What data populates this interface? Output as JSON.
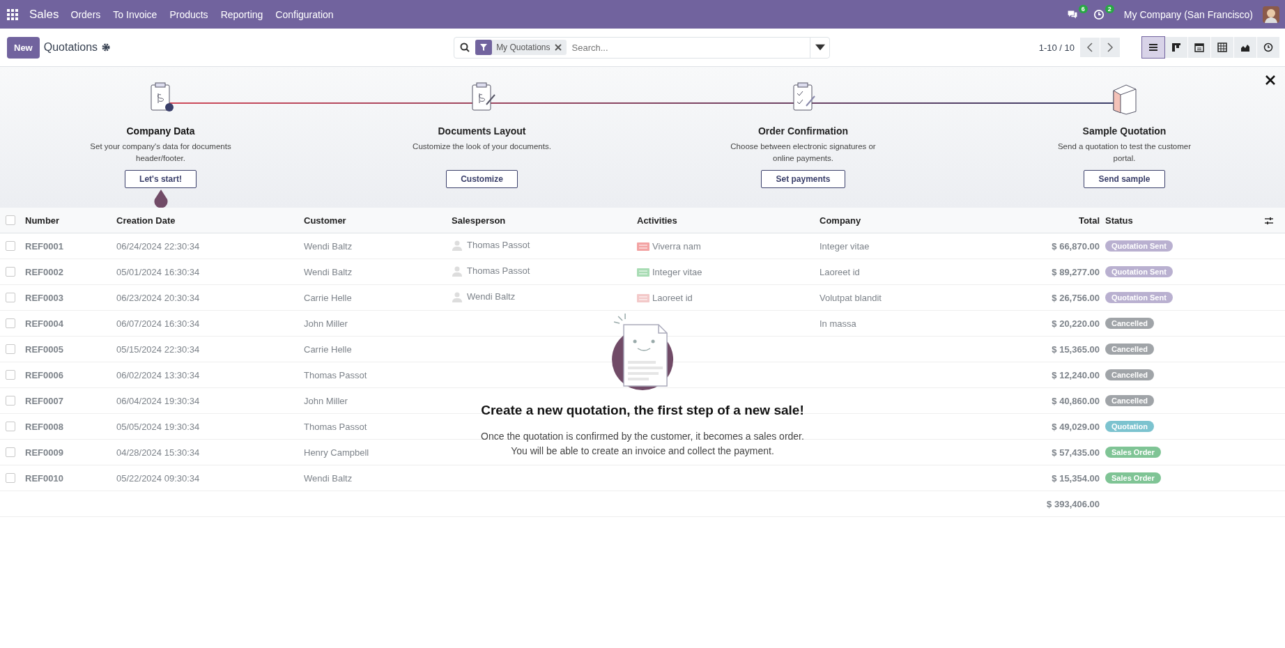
{
  "navbar": {
    "menu": [
      {
        "label": "Sales",
        "kind": "app"
      },
      {
        "label": "Orders",
        "kind": "menu"
      },
      {
        "label": "To Invoice",
        "kind": "menu"
      },
      {
        "label": "Products",
        "kind": "menu"
      },
      {
        "label": "Reporting",
        "kind": "menu"
      },
      {
        "label": "Configuration",
        "kind": "menu"
      }
    ],
    "messages_count": "6",
    "activities_count": "2",
    "company": "My Company (San Francisco)"
  },
  "control_panel": {
    "new_button": "New",
    "breadcrumb": "Quotations",
    "search": {
      "facet": "My Quotations",
      "placeholder": "Search..."
    },
    "pager": "1-10 / 10",
    "views": [
      {
        "kind": "list",
        "selected": true
      },
      {
        "kind": "kanban",
        "selected": false
      },
      {
        "kind": "calendar",
        "selected": false
      },
      {
        "kind": "pivot",
        "selected": false
      },
      {
        "kind": "graph",
        "selected": false
      },
      {
        "kind": "activity",
        "selected": false
      }
    ]
  },
  "onboarding": {
    "steps": [
      {
        "title": "Company Data",
        "description": "Set your company's data for documents header/footer.",
        "button": "Let's start!",
        "current": true
      },
      {
        "title": "Documents Layout",
        "description": "Customize the look of your documents.",
        "button": "Customize",
        "current": false
      },
      {
        "title": "Order Confirmation",
        "description": "Choose between electronic signatures or online payments.",
        "button": "Set payments",
        "current": false
      },
      {
        "title": "Sample Quotation",
        "description": "Send a quotation to test the customer portal.",
        "button": "Send sample",
        "current": false
      }
    ]
  },
  "table": {
    "columns": [
      "Number",
      "Creation Date",
      "Customer",
      "Salesperson",
      "Activities",
      "Company",
      "Total",
      "Status"
    ],
    "all_checked": false,
    "rows": [
      {
        "checked": false,
        "number": "REF0001",
        "date": "06/24/2024 22:30:34",
        "customer": "Wendi Baltz",
        "salesperson": "Thomas Passot",
        "activity": {
          "label": "Viverra nam",
          "color": "#f3a3a3"
        },
        "company": "Integer vitae",
        "total": "$ 66,870.00",
        "status": {
          "label": "Quotation Sent",
          "color": "#b9b0d0"
        }
      },
      {
        "checked": false,
        "number": "REF0002",
        "date": "05/01/2024 16:30:34",
        "customer": "Wendi Baltz",
        "salesperson": "Thomas Passot",
        "activity": {
          "label": "Integer vitae",
          "color": "#a8dcb4"
        },
        "company": "Laoreet id",
        "total": "$ 89,277.00",
        "status": {
          "label": "Quotation Sent",
          "color": "#b9b0d0"
        }
      },
      {
        "checked": false,
        "number": "REF0003",
        "date": "06/23/2024 20:30:34",
        "customer": "Carrie Helle",
        "salesperson": "Wendi Baltz",
        "activity": {
          "label": "Laoreet id",
          "color": "#f3c9c9"
        },
        "company": "Volutpat blandit",
        "total": "$ 26,756.00",
        "status": {
          "label": "Quotation Sent",
          "color": "#b9b0d0"
        }
      },
      {
        "checked": false,
        "number": "REF0004",
        "date": "06/07/2024 16:30:34",
        "customer": "John Miller",
        "company": "In massa",
        "total": "$ 20,220.00",
        "status": {
          "label": "Cancelled",
          "color": "#a0a4a8"
        }
      },
      {
        "checked": false,
        "number": "REF0005",
        "date": "05/15/2024 22:30:34",
        "customer": "Carrie Helle",
        "total": "$ 15,365.00",
        "status": {
          "label": "Cancelled",
          "color": "#a0a4a8"
        }
      },
      {
        "checked": false,
        "number": "REF0006",
        "date": "06/02/2024 13:30:34",
        "customer": "Thomas Passot",
        "total": "$ 12,240.00",
        "status": {
          "label": "Cancelled",
          "color": "#a0a4a8"
        }
      },
      {
        "checked": false,
        "number": "REF0007",
        "date": "06/04/2024 19:30:34",
        "customer": "John Miller",
        "total": "$ 40,860.00",
        "status": {
          "label": "Cancelled",
          "color": "#a0a4a8"
        }
      },
      {
        "checked": false,
        "number": "REF0008",
        "date": "05/05/2024 19:30:34",
        "customer": "Thomas Passot",
        "total": "$ 49,029.00",
        "status": {
          "label": "Quotation",
          "color": "#7cc3cf"
        }
      },
      {
        "checked": false,
        "number": "REF0009",
        "date": "04/28/2024 15:30:34",
        "customer": "Henry Campbell",
        "total": "$ 57,435.00",
        "status": {
          "label": "Sales Order",
          "color": "#7fc495"
        }
      },
      {
        "checked": false,
        "number": "REF0010",
        "date": "05/22/2024 09:30:34",
        "customer": "Wendi Baltz",
        "total": "$ 15,354.00",
        "status": {
          "label": "Sales Order",
          "color": "#7fc495"
        }
      }
    ],
    "sum": "$ 393,406.00"
  },
  "empty_state": {
    "title": "Create a new quotation, the first step of a new sale!",
    "lines": [
      "Once the quotation is confirmed by the customer, it becomes a sales order.",
      "You will be able to create an invoice and collect the payment."
    ]
  }
}
